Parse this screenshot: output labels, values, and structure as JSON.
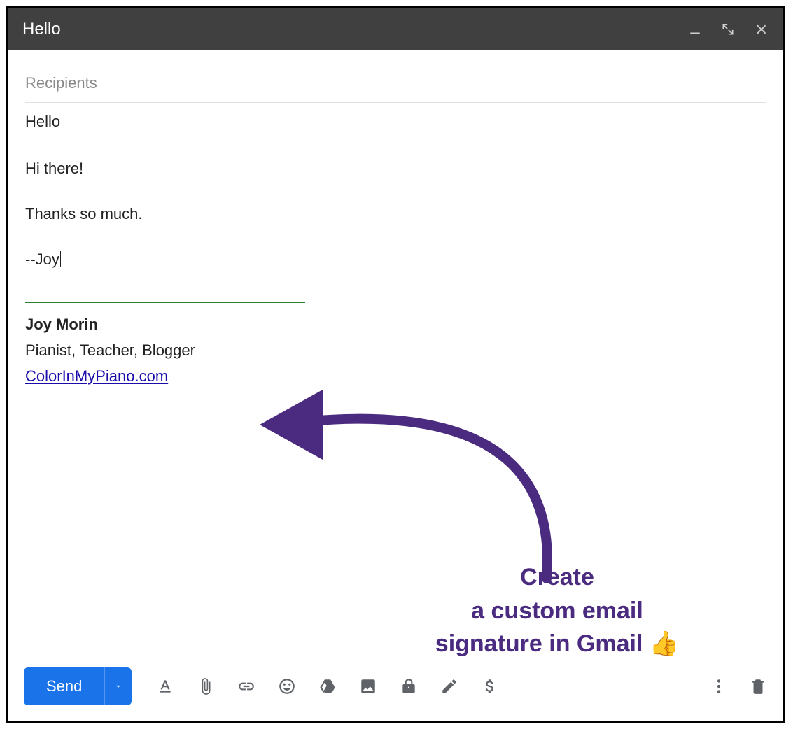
{
  "titlebar": {
    "title": "Hello"
  },
  "compose": {
    "recipients_placeholder": "Recipients",
    "subject": "Hello"
  },
  "body": {
    "line1": "Hi there!",
    "line2": "Thanks so much.",
    "signoff": "--Joy"
  },
  "signature": {
    "name": "Joy Morin",
    "role": "Pianist, Teacher, Blogger",
    "link": "ColorInMyPiano.com"
  },
  "annotation": {
    "line1": "Create",
    "line2": "a custom email",
    "line3_prefix": "signature in Gmail ",
    "emoji": "👍"
  },
  "toolbar": {
    "send_label": "Send",
    "icons": {
      "format": "formatting-icon",
      "attach": "attach-icon",
      "link": "link-icon",
      "emoji": "emoji-icon",
      "drive": "drive-icon",
      "image": "image-icon",
      "confidential": "confidential-icon",
      "pen": "pen-icon",
      "money": "money-icon",
      "more": "more-options-icon",
      "trash": "trash-icon"
    }
  },
  "colors": {
    "accent": "#1a73e8",
    "annotation": "#4b2b7f",
    "sig_divider": "#2e7d32",
    "link": "#1a0dab"
  }
}
